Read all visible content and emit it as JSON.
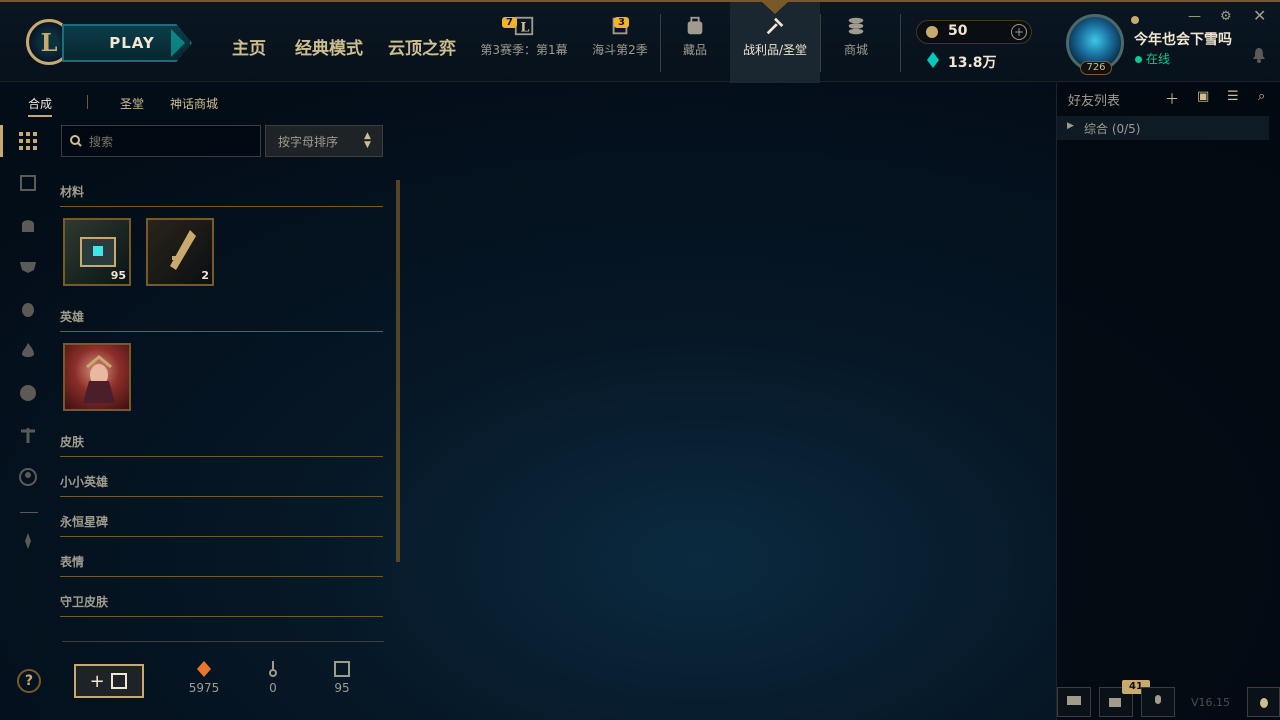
{
  "nav": {
    "play": "PLAY",
    "home": "主页",
    "classic": "经典模式",
    "tft": "云顶之弈"
  },
  "modes": [
    {
      "label": "第3赛季：第1幕",
      "badge": "7"
    },
    {
      "label": "海斗第2季",
      "badge": "3"
    }
  ],
  "tabs": {
    "collection": "藏品",
    "loot": "战利品/圣堂",
    "store": "商城"
  },
  "currency": {
    "gold": "50",
    "essence": "13.8万"
  },
  "user": {
    "name": "今年也会下雪吗",
    "status": "在线",
    "level": "726"
  },
  "subtabs": {
    "crafting": "合成",
    "sanctum": "圣堂",
    "mythic": "神话商城"
  },
  "search": {
    "placeholder": "搜索",
    "sort": "按字母排序"
  },
  "categories": {
    "materials": "材料",
    "champions": "英雄",
    "skins": "皮肤",
    "tacticians": "小小英雄",
    "eternals": "永恒星碑",
    "emotes": "表情",
    "ward": "守卫皮肤"
  },
  "materials": [
    {
      "name": "hextech-chest",
      "count": "95"
    },
    {
      "name": "hextech-key",
      "count": "2"
    }
  ],
  "resources": {
    "orange_essence": "5975",
    "keys": "0",
    "chests": "95"
  },
  "friends": {
    "title": "好友列表",
    "group": "综合 (0/5)"
  },
  "footer": {
    "chat_badge": "41",
    "version": "V16.15"
  },
  "colors": {
    "gold": "#c8aa6e",
    "teal": "#0ac8b9",
    "online": "#0acb8e"
  }
}
